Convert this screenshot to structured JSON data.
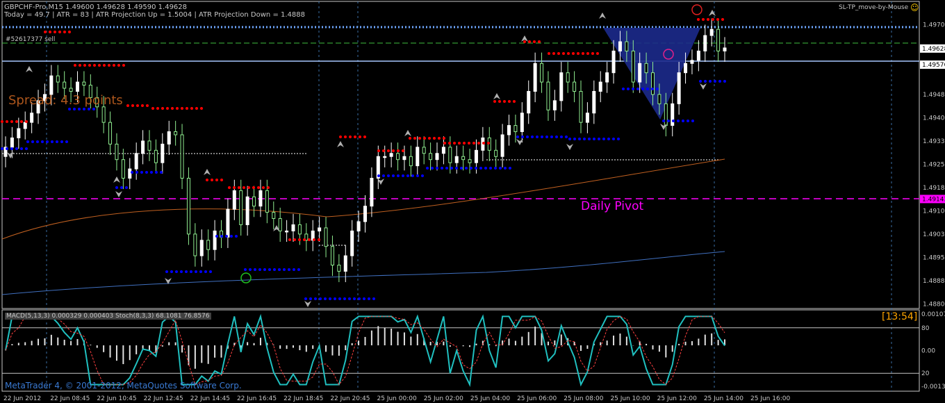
{
  "header": {
    "line1": "GBPCHF-Pro,M15  1.49600 1.49628 1.49590 1.49628",
    "line2": "Today = 49.7   |   ATR = 83   |   ATR Projection Up = 1.5004   |   ATR Projection Down = 1.4888"
  },
  "expert_name": "SL-TP_move-by-Mouse",
  "expert_icon": "smiley-icon",
  "order_label": "#52617377 sell",
  "spread_text": "Spread: 4.3 points",
  "pivot_label": "Daily Pivot",
  "timer": "[13:54]",
  "subwindow_label": "MACD(5,13,3) 0.000329 0.000403  Stoch(8,3,3) 68.1081 76.8576",
  "copyright": "MetaTrader 4, © 2001-2012, MetaQuotes Software Corp.",
  "colors": {
    "background": "#000000",
    "bull_candle": "#ffffff",
    "bear_candle": "#90ee90",
    "resistance_dots": "#ff0000",
    "support_dots": "#0000ff",
    "pivot": "#ff00ff",
    "stochastic_main": "#20c0c0",
    "stochastic_signal": "#ff4040",
    "spread_text": "#c06020",
    "timer": "#ffa500",
    "blue_triangle": "#1c2a8c"
  },
  "chart_data": [
    {
      "type": "candlestick",
      "symbol": "GBPCHF-Pro",
      "timeframe": "M15",
      "ylim": [
        1.4879,
        1.4978
      ],
      "y_ticks": [
        "1.49705",
        "1.49628",
        "1.49576",
        "1.49480",
        "1.49405",
        "1.49330",
        "1.49255",
        "1.49180",
        "1.49143",
        "1.49105",
        "1.49030",
        "1.48955",
        "1.48880",
        "1.48805"
      ],
      "price_markers": [
        {
          "value": "1.49628",
          "label": "bid"
        },
        {
          "value": "1.49576",
          "label": "order"
        },
        {
          "value": "1.49143",
          "label": "pivot"
        }
      ],
      "x_ticks": [
        "22 Jun 2012",
        "22 Jun 08:45",
        "22 Jun 10:45",
        "22 Jun 12:45",
        "22 Jun 14:45",
        "22 Jun 16:45",
        "22 Jun 18:45",
        "22 Jun 20:45",
        "25 Jun 00:00",
        "25 Jun 02:00",
        "25 Jun 04:00",
        "25 Jun 06:00",
        "25 Jun 08:00",
        "25 Jun 10:00",
        "25 Jun 12:00",
        "25 Jun 14:00",
        "25 Jun 16:00"
      ],
      "close": [
        1.4931,
        1.4934,
        1.4937,
        1.4939,
        1.4942,
        1.4946,
        1.4948,
        1.4954,
        1.4952,
        1.495,
        1.4949,
        1.4952,
        1.4951,
        1.4947,
        1.4944,
        1.4939,
        1.4932,
        1.4927,
        1.4921,
        1.4924,
        1.4929,
        1.4933,
        1.493,
        1.4926,
        1.4932,
        1.4936,
        1.4935,
        1.4921,
        1.4903,
        1.4896,
        1.4901,
        1.4898,
        1.4904,
        1.4902,
        1.4911,
        1.4917,
        1.4906,
        1.4915,
        1.4912,
        1.4917,
        1.491,
        1.4908,
        1.4904,
        1.4904,
        1.4906,
        1.4903,
        1.4901,
        1.4904,
        1.4905,
        1.4899,
        1.4893,
        1.4891,
        1.4896,
        1.4904,
        1.4907,
        1.4912,
        1.4921,
        1.4928,
        1.4928,
        1.4929,
        1.4927,
        1.4928,
        1.4925,
        1.4931,
        1.4929,
        1.4927,
        1.4929,
        1.4931,
        1.4926,
        1.4928,
        1.4927,
        1.4926,
        1.493,
        1.4934,
        1.493,
        1.4928,
        1.4935,
        1.4938,
        1.4936,
        1.4942,
        1.4949,
        1.4958,
        1.4952,
        1.4943,
        1.4946,
        1.4955,
        1.4952,
        1.4949,
        1.4939,
        1.4942,
        1.4949,
        1.4952,
        1.4955,
        1.4962,
        1.4965,
        1.4962,
        1.4952,
        1.4958,
        1.4955,
        1.4948,
        1.4945,
        1.4938,
        1.4945,
        1.4955,
        1.4958,
        1.4959,
        1.4962,
        1.4967,
        1.4969,
        1.4962,
        1.4963
      ],
      "macd_histogram_color": "#e0e0e0",
      "overbought": 80,
      "oversold": 20
    }
  ]
}
